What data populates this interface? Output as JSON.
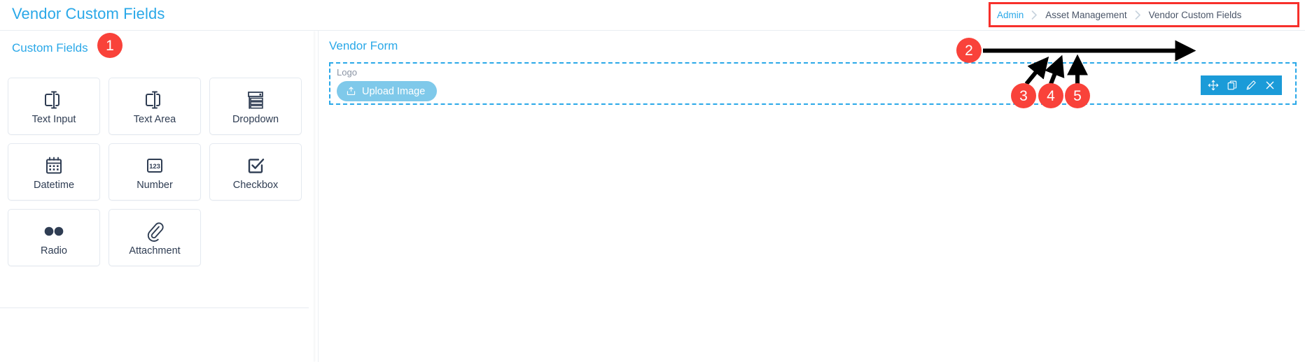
{
  "header": {
    "title": "Vendor Custom Fields",
    "breadcrumb": {
      "separator_icon": "chevron-right-icon",
      "items": [
        {
          "label": "Admin",
          "is_link": true
        },
        {
          "label": "Asset Management",
          "is_link": false
        },
        {
          "label": "Vendor Custom Fields",
          "is_link": false
        }
      ]
    }
  },
  "colors": {
    "brand_blue": "#2aa8e8",
    "toolbar_blue": "#1b9bd8",
    "upload_button_blue": "#7fc9ea",
    "annotation_red": "#f9423a",
    "text_dark": "#2f3d53",
    "text_muted": "#8a94a4",
    "border_light": "#e4e9f0"
  },
  "left_panel": {
    "title": "Custom Fields",
    "cards": [
      {
        "label": "Text Input",
        "icon": "text-input-icon"
      },
      {
        "label": "Text Area",
        "icon": "text-area-icon"
      },
      {
        "label": "Dropdown",
        "icon": "dropdown-icon"
      },
      {
        "label": "Datetime",
        "icon": "calendar-icon"
      },
      {
        "label": "Number",
        "icon": "number-123-icon"
      },
      {
        "label": "Checkbox",
        "icon": "checkbox-checked-icon"
      },
      {
        "label": "Radio",
        "icon": "radio-dots-icon"
      },
      {
        "label": "Attachment",
        "icon": "paperclip-icon"
      }
    ]
  },
  "right_panel": {
    "title": "Vendor Form",
    "field": {
      "label": "Logo",
      "upload_button": {
        "label": "Upload Image",
        "icon": "upload-icon"
      },
      "toolbar": [
        {
          "name": "move",
          "icon": "arrows-move-icon",
          "title": "Move"
        },
        {
          "name": "duplicate",
          "icon": "copy-icon",
          "title": "Duplicate"
        },
        {
          "name": "edit",
          "icon": "pencil-icon",
          "title": "Edit"
        },
        {
          "name": "remove",
          "icon": "close-x-icon",
          "title": "Remove"
        }
      ]
    }
  },
  "annotations": [
    {
      "id": "badge-1",
      "label": "1"
    },
    {
      "id": "badge-2",
      "label": "2"
    },
    {
      "id": "badge-3",
      "label": "3"
    },
    {
      "id": "badge-4",
      "label": "4"
    },
    {
      "id": "badge-5",
      "label": "5"
    }
  ]
}
